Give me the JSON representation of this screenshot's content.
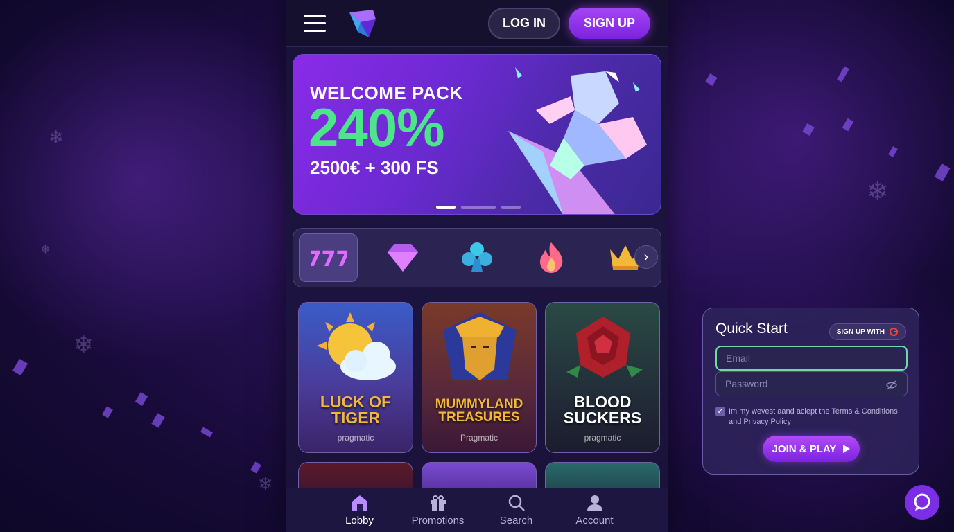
{
  "header": {
    "login_label": "LOG IN",
    "signup_label": "SIGN UP"
  },
  "banner": {
    "line1": "WELCOME PACK",
    "line2": "240%",
    "line3": "2500€ + 300 FS"
  },
  "categories": [
    "slots-777-icon",
    "diamond-icon",
    "club-icon",
    "flame-icon",
    "crown-icon"
  ],
  "games": [
    {
      "title_line1": "LUCK OF",
      "title_line2": "TIGER",
      "provider": "pragmatic",
      "title_color": "#f2b838"
    },
    {
      "title_line1": "MUMMYLAND",
      "title_line2": "TREASURES",
      "provider": "Pragmatic",
      "title_color": "#f2b838"
    },
    {
      "title_line1": "BLOOD",
      "title_line2": "SUCKERS",
      "provider": "pragmatic",
      "title_color": "#ffffff"
    }
  ],
  "bottom_nav": [
    {
      "label": "Lobby",
      "icon": "home-icon"
    },
    {
      "label": "Promotions",
      "icon": "gift-icon"
    },
    {
      "label": "Search",
      "icon": "search-icon"
    },
    {
      "label": "Account",
      "icon": "user-icon"
    }
  ],
  "quick_start": {
    "title": "Quick Start",
    "google_label": "SIGN UP WITH",
    "email_placeholder": "Email",
    "password_placeholder": "Password",
    "terms": "Im my wevest aand aclept the Terms & Conditions and Privacy Policy",
    "join_label": "JOIN & PLAY"
  },
  "colors": {
    "accent": "#8a2be8",
    "green": "#4de58a",
    "gold": "#f2b838"
  }
}
